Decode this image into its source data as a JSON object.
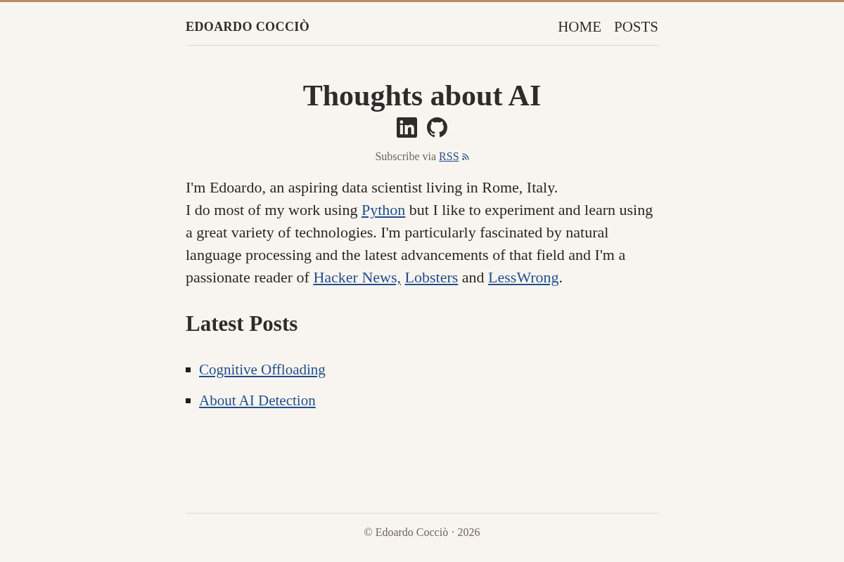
{
  "header": {
    "site_title": "EDOARDO COCCIÒ",
    "nav": [
      {
        "label": "HOME"
      },
      {
        "label": "POSTS"
      }
    ]
  },
  "hero": {
    "title": "Thoughts about AI",
    "subscribe": {
      "text": "Subscribe via",
      "link": "RSS"
    }
  },
  "intro": [
    [
      {
        "kind": "text",
        "text": "I'm Edoardo, an aspiring data scientist living in Rome, Italy."
      }
    ],
    [
      {
        "kind": "text",
        "text": "I do most of my work using "
      },
      {
        "kind": "link",
        "text": "Python"
      },
      {
        "kind": "text",
        "text": " but I like to experiment and learn using a great variety of technologies. I'm particularly fascinated by natural language processing and the latest advancements of that field and I'm a passionate reader of "
      },
      {
        "kind": "link",
        "text": "Hacker News,"
      },
      {
        "kind": "link",
        "text": "Lobsters"
      },
      {
        "kind": "text",
        "text": " and "
      },
      {
        "kind": "link",
        "text": "LessWrong"
      },
      {
        "kind": "text",
        "text": "."
      }
    ]
  ],
  "latest_posts": {
    "heading": "Latest Posts",
    "posts": [
      {
        "title": "Cognitive Offloading"
      },
      {
        "title": "About AI Detection"
      }
    ]
  },
  "footer": {
    "text": "© Edoardo Cocciò · 2026"
  }
}
